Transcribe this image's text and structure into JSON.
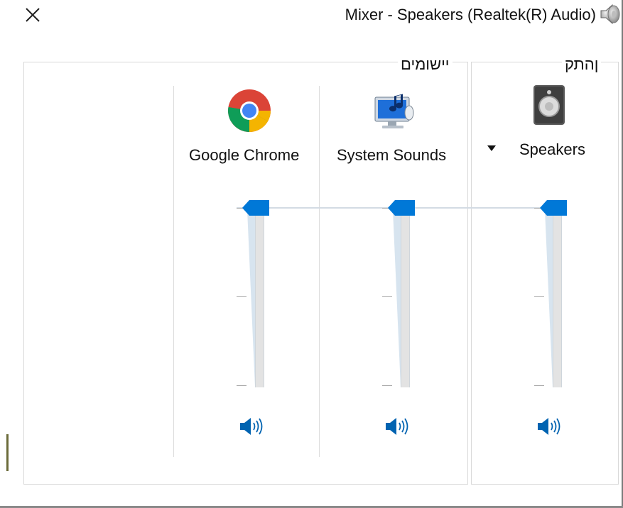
{
  "window": {
    "title": "Mixer - Speakers (Realtek(R) Audio)",
    "close_icon": "close-icon",
    "title_icon": "speaker-volume-icon"
  },
  "sections": {
    "applications_label": "יישומים",
    "device_label_main": "התק",
    "device_label_accel": "ן"
  },
  "device": {
    "name": "Speakers",
    "icon": "speaker-device-icon",
    "volume_percent": 100,
    "mute_icon": "speaker-unmuted-icon"
  },
  "applications": [
    {
      "name": "System Sounds",
      "icon": "system-sounds-icon",
      "volume_percent": 100,
      "mute_icon": "speaker-unmuted-icon"
    },
    {
      "name": "Google Chrome",
      "icon": "chrome-icon",
      "volume_percent": 100,
      "mute_icon": "speaker-unmuted-icon"
    }
  ],
  "colors": {
    "accent": "#0063B1",
    "thumb": "#0078D7",
    "track": "#E3E3E3"
  }
}
